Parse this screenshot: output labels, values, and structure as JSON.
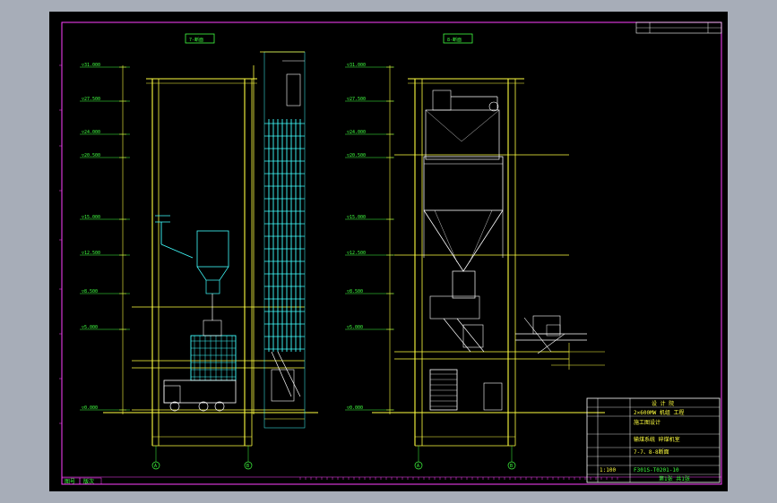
{
  "colors": {
    "background": "#a7adb8",
    "sheet": "#000000",
    "frame": "#ff40ff",
    "structure": "#ffff40",
    "equipment": "#40ffff",
    "dimension": "#40ff40",
    "white": "#ffffff",
    "red": "#ff4040"
  },
  "views": {
    "left_title": "7-断面",
    "right_title": "8-断面"
  },
  "elevation_labels": {
    "left": [
      "▽31.000",
      "▽27.500",
      "▽24.000",
      "▽20.500",
      "▽15.000",
      "▽12.500",
      "▽8.500",
      "▽5.000",
      "▽0.000"
    ],
    "right": [
      "▽31.000",
      "▽27.500",
      "▽24.000",
      "▽20.500",
      "▽15.000",
      "▽12.500",
      "▽8.500",
      "▽5.000",
      "▽0.000"
    ]
  },
  "axis_markers": [
    "A",
    "B",
    "A",
    "B"
  ],
  "title_block": {
    "company": "设 计 院",
    "project": "2×600MW 机组 工程",
    "phase": "施工图设计",
    "drawing_name": "输煤系统 碎煤机室",
    "drawing_sub": "7-7、8-8断面",
    "scale": "1:100",
    "drawing_no": "F301S-T0201-10",
    "sheet": "第1张 共1张"
  },
  "bottom_strip": [
    "图号",
    "版次"
  ]
}
